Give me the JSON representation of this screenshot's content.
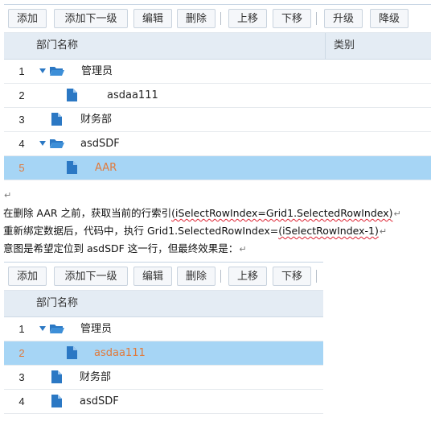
{
  "grid1": {
    "toolbar": {
      "add": "添加",
      "add_child": "添加下一级",
      "edit": "编辑",
      "delete": "删除",
      "move_up": "上移",
      "move_down": "下移",
      "upgrade": "升级",
      "downgrade": "降级"
    },
    "columns": {
      "name": "部门名称",
      "category": "类别"
    },
    "rows": [
      {
        "num": "1",
        "name": "管理员"
      },
      {
        "num": "2",
        "name": "asdaa111"
      },
      {
        "num": "3",
        "name": "财务部"
      },
      {
        "num": "4",
        "name": "asdSDF"
      },
      {
        "num": "5",
        "name": "AAR"
      }
    ]
  },
  "notes": {
    "mark": "↵",
    "line1_a": "在删除 AAR 之前，获取当前的行索引",
    "line1_b": "(iSelectRowIndex=Grid1.SelectedRowIndex)",
    "line2_a": "重新绑定数据后，代码中，执行 Grid1.SelectedRowIndex=",
    "line2_b": "(iSelectRowIndex-1)",
    "line3": "意图是希望定位到 asdSDF 这一行，但最终效果是："
  },
  "grid2": {
    "toolbar": {
      "add": "添加",
      "add_child": "添加下一级",
      "edit": "编辑",
      "delete": "删除",
      "move_up": "上移",
      "move_down": "下移"
    },
    "columns": {
      "name": "部门名称"
    },
    "rows": [
      {
        "num": "1",
        "name": "管理员"
      },
      {
        "num": "2",
        "name": "asdaa111"
      },
      {
        "num": "3",
        "name": "财务部"
      },
      {
        "num": "4",
        "name": "asdSDF"
      }
    ]
  },
  "icons": {
    "folder": "folder-open-icon",
    "file": "file-icon",
    "expand": "expand-arrow-icon"
  },
  "colors": {
    "selected_row": "#a6d5f5",
    "selected_text": "#e07a3c",
    "icon_blue": "#2b78c4",
    "header_bg": "#e4ecf4"
  }
}
